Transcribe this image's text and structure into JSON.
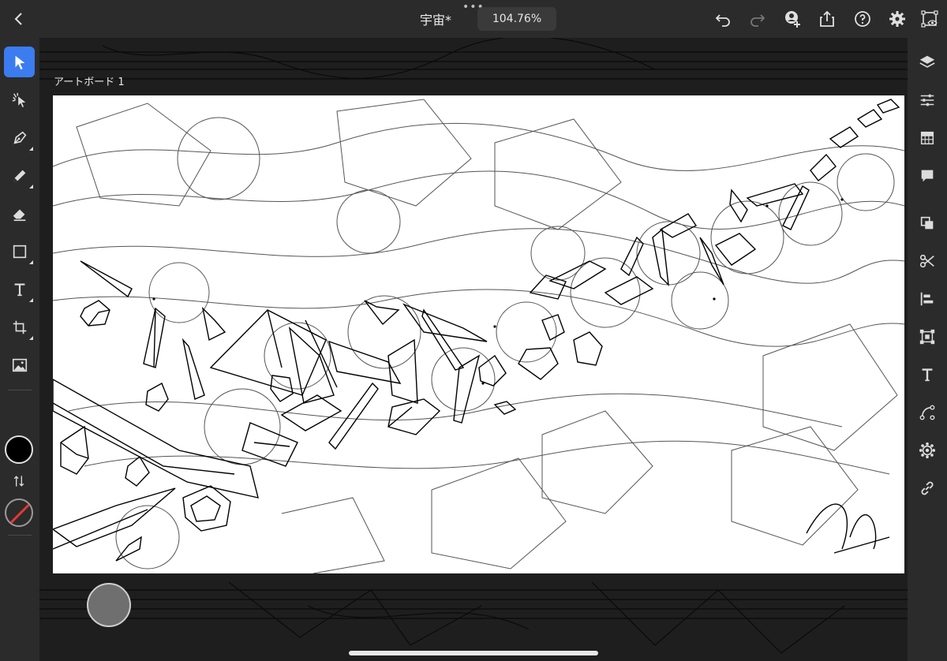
{
  "app": {
    "document_title": "宇宙*",
    "zoom_level": "104.76%",
    "artboard_label": "アートボード 1",
    "accent_color": "#3b7cf0"
  },
  "top_bar": {
    "icons": [
      "back-chevron-icon",
      "more-dots-icon",
      "undo-icon",
      "redo-icon",
      "invite-user-icon",
      "share-icon",
      "help-icon",
      "settings-icon",
      "preview-icon"
    ]
  },
  "left_toolbar": {
    "tools": [
      "selection-tool",
      "direct-selection-tool",
      "pen-tool",
      "pencil-tool",
      "eraser-tool",
      "shape-tool",
      "type-tool",
      "transform-tool",
      "image-tool"
    ],
    "active_tool": "selection-tool",
    "fill_color": "#000000",
    "stroke_color": "none"
  },
  "right_toolbar": {
    "panels": [
      "layers-icon",
      "properties-icon",
      "color-icon",
      "comments-icon",
      "combine-icon",
      "scissors-icon",
      "align-icon",
      "transform-icon",
      "type-panel-icon",
      "path-icon",
      "appearance-icon",
      "link-icon"
    ]
  }
}
